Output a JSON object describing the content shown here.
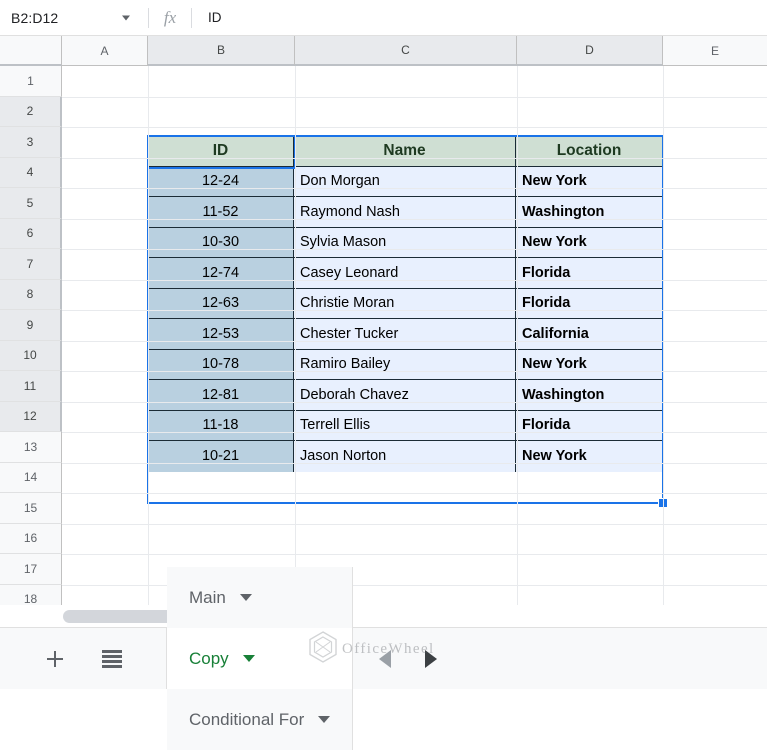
{
  "formula_bar": {
    "name_box_value": "B2:D12",
    "fx_label": "fx",
    "formula_value": "ID"
  },
  "grid": {
    "column_headers": [
      "A",
      "B",
      "C",
      "D",
      "E"
    ],
    "selected_columns": [
      "B",
      "C",
      "D"
    ],
    "row_headers": [
      "1",
      "2",
      "3",
      "4",
      "5",
      "6",
      "7",
      "8",
      "9",
      "10",
      "11",
      "12",
      "13",
      "14",
      "15",
      "16",
      "17",
      "18"
    ],
    "selected_rows": [
      "2",
      "3",
      "4",
      "5",
      "6",
      "7",
      "8",
      "9",
      "10",
      "11",
      "12"
    ]
  },
  "table": {
    "headers": [
      "ID",
      "Name",
      "Location"
    ],
    "rows": [
      [
        "12-24",
        "Don Morgan",
        "New York"
      ],
      [
        "11-52",
        "Raymond Nash",
        "Washington"
      ],
      [
        "10-30",
        "Sylvia Mason",
        "New York"
      ],
      [
        "12-74",
        "Casey Leonard",
        "Florida"
      ],
      [
        "12-63",
        "Christie Moran",
        "Florida"
      ],
      [
        "12-53",
        "Chester Tucker",
        "California"
      ],
      [
        "10-78",
        "Ramiro Bailey",
        "New York"
      ],
      [
        "12-81",
        "Deborah Chavez",
        "Washington"
      ],
      [
        "11-18",
        "Terrell Ellis",
        "Florida"
      ],
      [
        "10-21",
        "Jason Norton",
        "New York"
      ]
    ],
    "colors": {
      "header_fill": "#cfdfd3",
      "header_text": "#1e3a21",
      "id_fill": "#b9d0e0",
      "data_fill": "#e8f0fe",
      "selection_border": "#1a73e8"
    }
  },
  "tabbar": {
    "add_sheet_label": "+",
    "all_sheets_label": "all-sheets",
    "tabs": [
      {
        "label": "Main",
        "active": false
      },
      {
        "label": "Copy",
        "active": true
      },
      {
        "label": "Conditional For",
        "active": false
      }
    ],
    "nav_prev_label": "previous-sheet",
    "nav_next_label": "next-sheet"
  },
  "watermark": {
    "text": "OfficeWheel"
  }
}
